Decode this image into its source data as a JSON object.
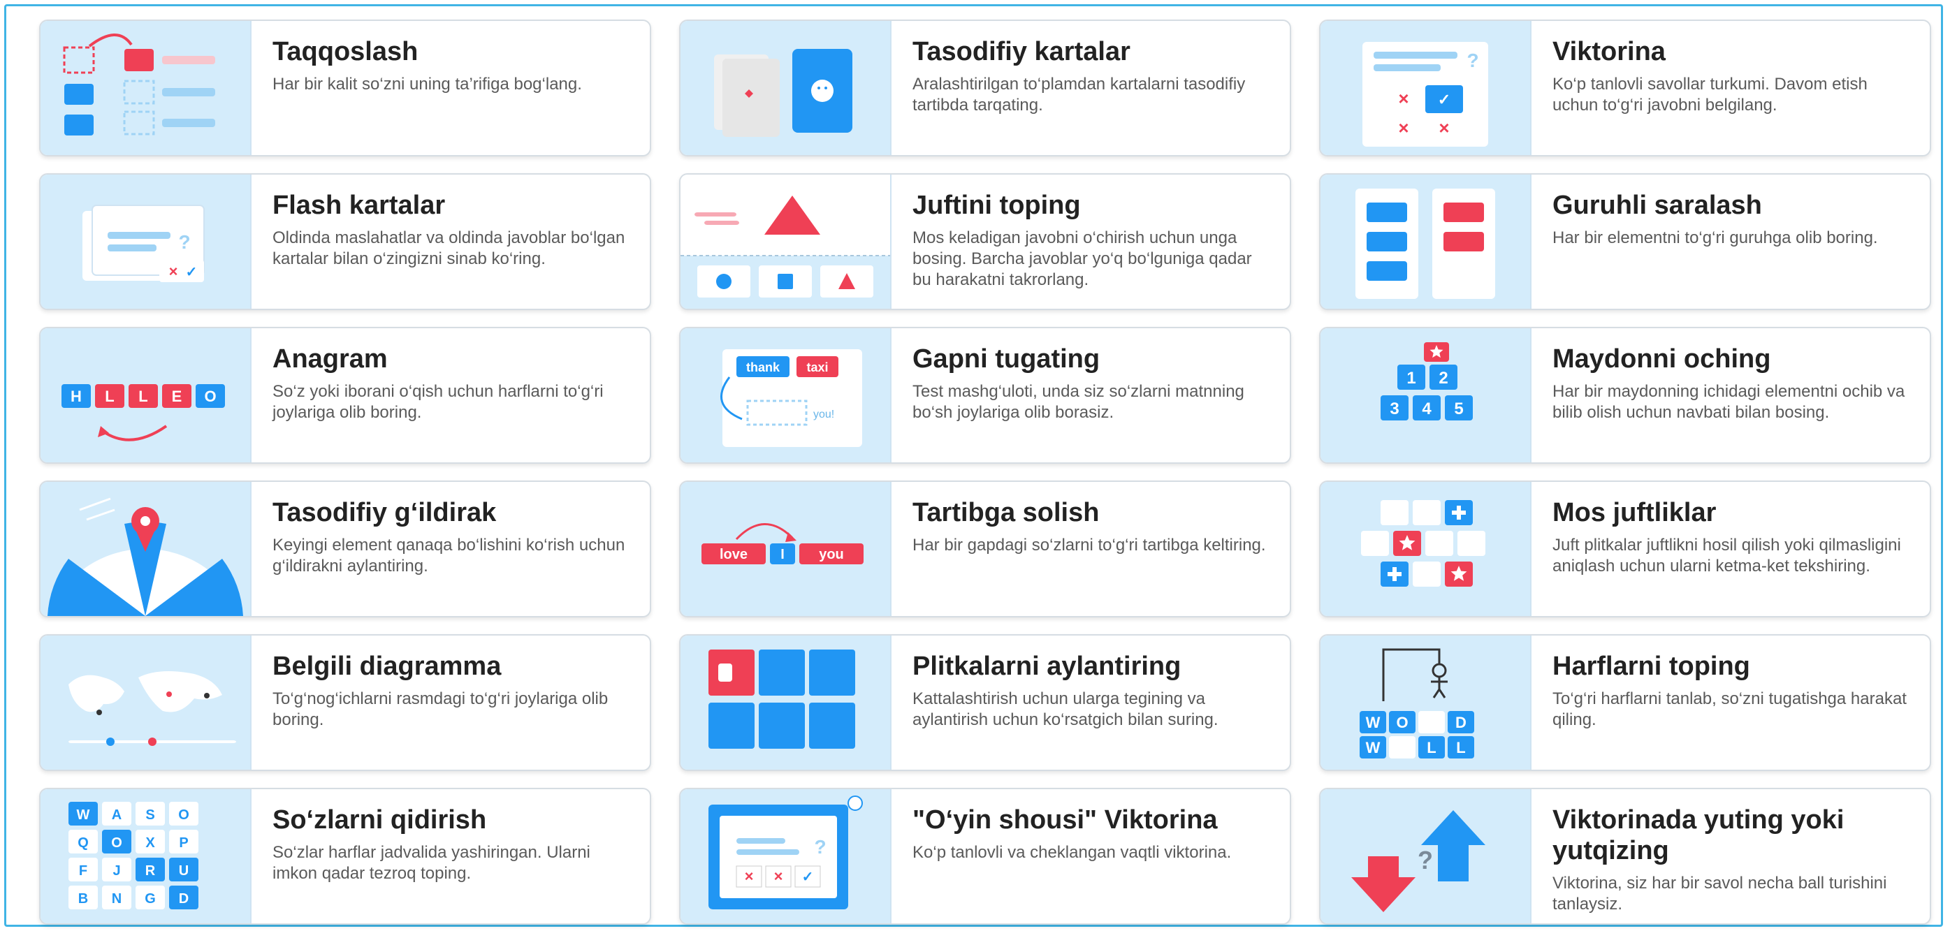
{
  "colors": {
    "accent": "#2196f3",
    "red": "#ef4055",
    "thumb_bg": "#d4ecfb",
    "frame": "#40b4e5"
  },
  "templates": [
    {
      "icon": "match-up-icon",
      "title": "Taqqoslash",
      "desc": "Har bir kalit so‘zni uning ta’rifiga bog‘lang."
    },
    {
      "icon": "random-cards-icon",
      "title": "Tasodifiy kartalar",
      "desc": "Aralashtirilgan to‘plamdan kartalarni tasodifiy tartibda tarqating."
    },
    {
      "icon": "quiz-icon",
      "title": "Viktorina",
      "desc": "Ko‘p tanlovli savollar turkumi. Davom etish uchun to‘g‘ri javobni belgilang."
    },
    {
      "icon": "flash-cards-icon",
      "title": "Flash kartalar",
      "desc": "Oldinda maslahatlar va oldinda javoblar bo‘lgan kartalar bilan o‘zingizni sinab ko‘ring."
    },
    {
      "icon": "find-match-icon",
      "title": "Juftini toping",
      "desc": "Mos keladigan javobni o‘chirish uchun unga bosing. Barcha javoblar yo‘q bo‘lguniga qadar bu harakatni takrorlang."
    },
    {
      "icon": "group-sort-icon",
      "title": "Guruhli saralash",
      "desc": "Har bir elementni to‘g‘ri guruhga olib boring."
    },
    {
      "icon": "anagram-icon",
      "title": "Anagram",
      "desc": "So‘z yoki iborani o‘qish uchun harflarni to‘g‘ri joylariga olib boring.",
      "letters": [
        "H",
        "L",
        "L",
        "E",
        "O"
      ]
    },
    {
      "icon": "complete-sentence-icon",
      "title": "Gapni tugating",
      "desc": "Test mashg‘uloti, unda siz so‘zlarni matnning bo‘sh joylariga olib borasiz.",
      "words": [
        "thank",
        "taxi",
        "you!"
      ]
    },
    {
      "icon": "open-box-icon",
      "title": "Maydonni oching",
      "desc": "Har bir maydonning ichidagi elementni ochib va bilib olish uchun navbati bilan bosing.",
      "numbers": [
        "1",
        "2",
        "3",
        "4",
        "5"
      ]
    },
    {
      "icon": "spin-wheel-icon",
      "title": "Tasodifiy g‘ildirak",
      "desc": "Keyingi element qanaqa bo‘lishini ko‘rish uchun g‘ildirakni aylantiring."
    },
    {
      "icon": "unjumble-icon",
      "title": "Tartibga solish",
      "desc": "Har bir gapdagi so‘zlarni to‘g‘ri tartibga keltiring.",
      "words": [
        "love",
        "I",
        "you"
      ]
    },
    {
      "icon": "matching-pairs-icon",
      "title": "Mos juftliklar",
      "desc": "Juft plitkalar juftlikni hosil qilish yoki qilmasligini aniqlash uchun ularni ketma-ket tekshiring."
    },
    {
      "icon": "labelled-diagram-icon",
      "title": "Belgili diagramma",
      "desc": "To‘g‘nog‘ichlarni rasmdagi to‘g‘ri joylariga olib boring."
    },
    {
      "icon": "flip-tiles-icon",
      "title": "Plitkalarni aylantiring",
      "desc": "Kattalashtirish uchun ularga tegining va aylantirish uchun ko‘rsatgich bilan suring."
    },
    {
      "icon": "hangman-icon",
      "title": "Harflarni toping",
      "desc": "To‘g‘ri harflarni tanlab, so‘zni tugatishga harakat qiling.",
      "letters": [
        "W",
        "O",
        "D",
        "W",
        "L",
        "L"
      ]
    },
    {
      "icon": "wordsearch-icon",
      "title": "So‘zlarni qidirish",
      "desc": "So‘zlar harflar jadvalida yashiringan. Ularni imkon qadar tezroq toping.",
      "letters": [
        "W",
        "A",
        "S",
        "O",
        "Q",
        "O",
        "X",
        "P",
        "F",
        "J",
        "R",
        "U",
        "B",
        "N",
        "G",
        "D"
      ]
    },
    {
      "icon": "gameshow-quiz-icon",
      "title": "\"O‘yin shousi\" Viktorina",
      "desc": "Ko‘p tanlovli va cheklangan vaqtli viktorina."
    },
    {
      "icon": "win-or-lose-quiz-icon",
      "title": "Viktorinada yuting yoki yutqizing",
      "desc": "Viktorina, siz har bir savol necha ball turishini tanlaysiz."
    }
  ]
}
